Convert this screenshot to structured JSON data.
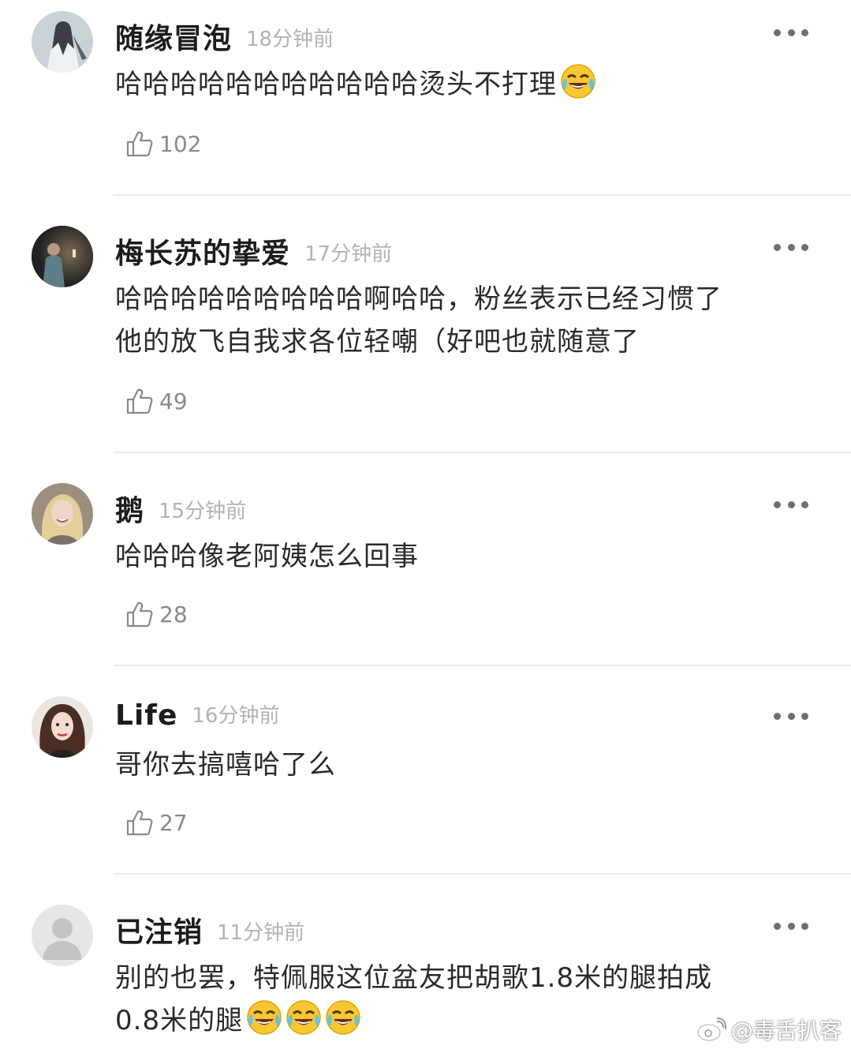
{
  "comments": [
    {
      "author": "随缘冒泡",
      "time": "18分钟前",
      "text_lines": [
        "哈哈哈哈哈哈哈哈哈哈哈烫头不打理"
      ],
      "trailing_emojis": [
        "laugh-cry-emoji"
      ],
      "likes": "102"
    },
    {
      "author": "梅长苏的挚爱",
      "time": "17分钟前",
      "text_lines": [
        "哈哈哈哈哈哈哈哈哈啊哈哈，粉丝表示已经习惯了",
        "他的放飞自我求各位轻嘲（好吧也就随意了"
      ],
      "trailing_emojis": [],
      "likes": "49"
    },
    {
      "author": "鹅",
      "time": "15分钟前",
      "text_lines": [
        "哈哈哈像老阿姨怎么回事"
      ],
      "trailing_emojis": [],
      "likes": "28"
    },
    {
      "author": "Life",
      "time": "16分钟前",
      "text_lines": [
        "哥你去搞嘻哈了么"
      ],
      "trailing_emojis": [],
      "likes": "27"
    },
    {
      "author": "已注销",
      "time": "11分钟前",
      "text_lines": [
        "别的也罢，特佩服这位盆友把胡歌1.8米的腿拍成",
        "0.8米的腿"
      ],
      "trailing_emojis": [
        "laugh-cry-emoji",
        "laugh-cry-emoji",
        "laugh-cry-emoji"
      ],
      "likes": ""
    }
  ],
  "watermark": "@毒舌扒客",
  "icons": {
    "like": "thumbs-up-icon",
    "more": "more-dots-icon",
    "watermark": "weibo-logo-icon"
  },
  "colors": {
    "time": "#b3b3b3",
    "like": "#8a8a8a",
    "divider": "#ececec"
  }
}
